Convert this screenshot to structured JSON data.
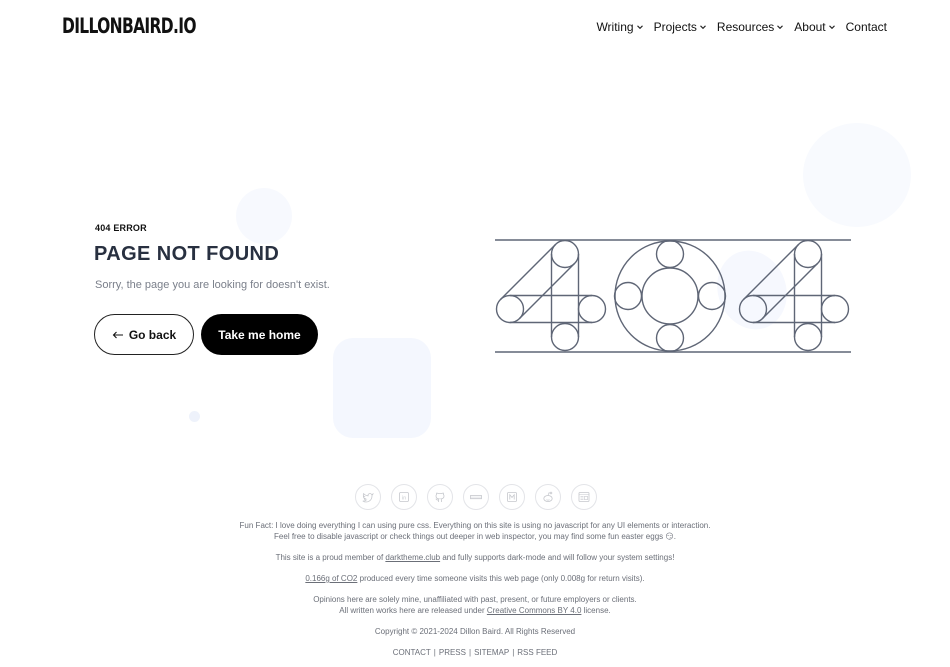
{
  "header": {
    "logo": "DILLONBAIRD.IO",
    "nav": [
      {
        "label": "Writing",
        "dropdown": true
      },
      {
        "label": "Projects",
        "dropdown": true
      },
      {
        "label": "Resources",
        "dropdown": true
      },
      {
        "label": "About",
        "dropdown": true
      },
      {
        "label": "Contact",
        "dropdown": false
      }
    ]
  },
  "main": {
    "error_label": "404 ERROR",
    "title": "PAGE NOT FOUND",
    "subtitle": "Sorry, the page you are looking for doesn't exist.",
    "back_button": {
      "icon": "arrow-left-icon",
      "label": "Go back"
    },
    "home_button": {
      "label": "Take me home"
    },
    "illustration": {
      "text": "404",
      "stroke_color": "#5f6676"
    }
  },
  "footer": {
    "social_icons": [
      "twitter-icon",
      "linkedin-icon",
      "github-icon",
      "npm-icon",
      "medium-icon",
      "reddit-icon",
      "newsletter-icon"
    ],
    "fun_fact_line1": "Fun Fact: I love doing everything I can using pure css. Everything on this site is using no javascript for any UI elements or interaction.",
    "fun_fact_line2": "Feel free to disable javascript or check things out deeper in web inspector, you may find some fun easter eggs 😏.",
    "darktheme_prefix": "This site is a proud member of ",
    "darktheme_link": "darktheme.club",
    "darktheme_suffix": " and fully supports dark-mode and will follow your system settings!",
    "co2_link": "0.166g of CO2",
    "co2_suffix": " produced every time someone visits this web page (only 0.008g for return visits).",
    "opinions": "Opinions here are solely mine, unaffiliated with past, present, or future employers or clients.",
    "license_prefix": "All written works here are released under ",
    "license_link": "Creative Commons BY 4.0",
    "license_suffix": " license.",
    "copyright": "Copyright © 2021-2024 Dillon Baird. All Rights Reserved",
    "links": [
      "CONTACT",
      "PRESS",
      "SITEMAP",
      "RSS FEED"
    ],
    "link_separator": "|"
  },
  "colors": {
    "background": "#ffffff",
    "title": "#283040",
    "muted_text": "#7a7f8a",
    "primary_button": "#000000",
    "blob": "#f5f8fe"
  }
}
